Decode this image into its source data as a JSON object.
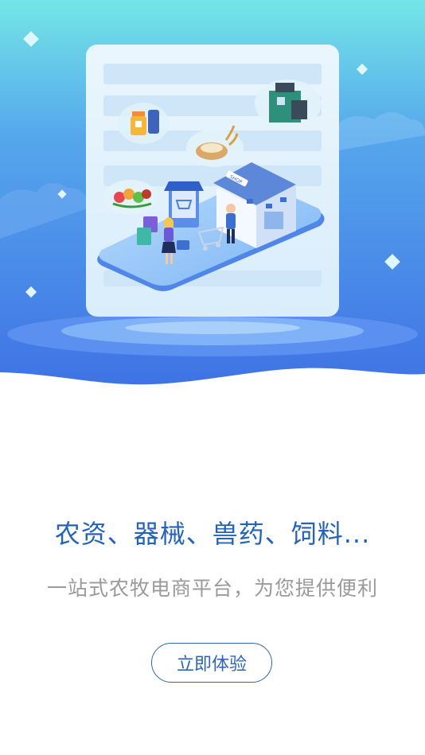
{
  "onboarding": {
    "headline": "农资、器械、兽药、饲料...",
    "tagline": "一站式农牧电商平台，为您提供便利",
    "cta_label": "立即体验"
  },
  "illustration": {
    "shop_sign": "SHOP",
    "icons": [
      "medicine-bottle-icon",
      "grain-icon",
      "machine-icon",
      "vegetables-icon",
      "shopping-cart-icon",
      "shopping-bag-icon"
    ]
  },
  "colors": {
    "background_top": "#6fe3e6",
    "background_bottom": "#3f74e6",
    "headline": "#2363b8",
    "tagline": "#9a9a9a",
    "button_border": "#2c66b5"
  }
}
